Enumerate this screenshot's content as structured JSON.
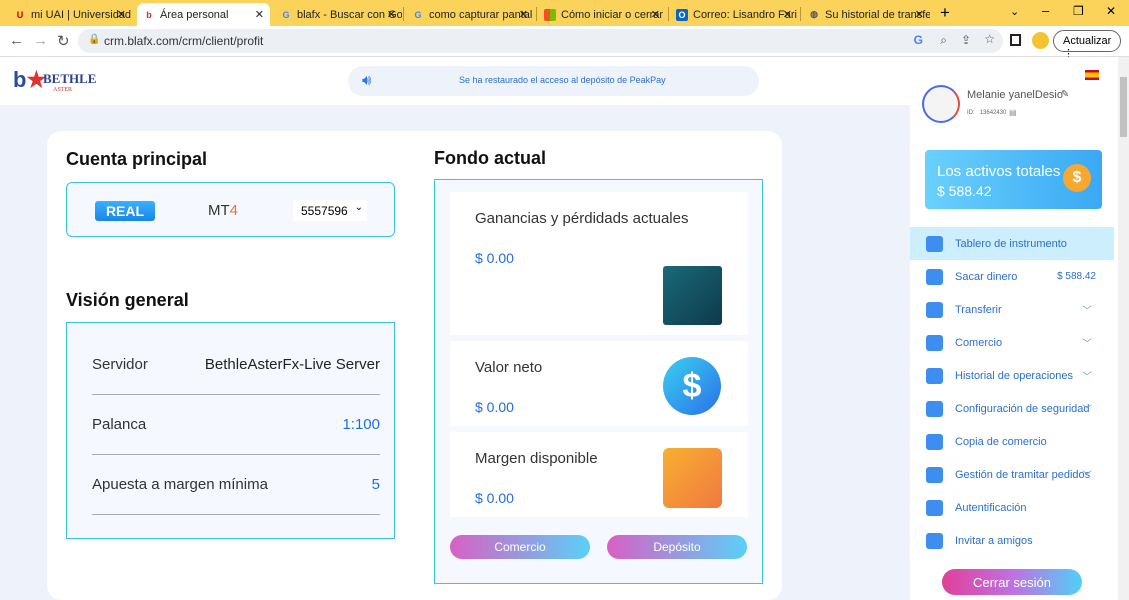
{
  "browser": {
    "tabs": [
      {
        "label": "mi UAI | Universidad A",
        "icon": "uai-icon"
      },
      {
        "label": "Área personal",
        "icon": "bethle-icon",
        "active": true
      },
      {
        "label": "blafx - Buscar con Go",
        "icon": "google-icon"
      },
      {
        "label": "como capturar pantal",
        "icon": "google-icon"
      },
      {
        "label": "Cómo iniciar o cerrar",
        "icon": "microsoft-icon"
      },
      {
        "label": "Correo: Lisandro Fari",
        "icon": "outlook-icon"
      },
      {
        "label": "Su historial de transfe",
        "icon": "globe-icon"
      }
    ],
    "url": "crm.blafx.com/crm/client/profit",
    "update_label": "Actualizar"
  },
  "header": {
    "logo_top": "BETHLE",
    "logo_bottom": "ASTER",
    "notice": "Se ha restaurado el acceso al depósito de PeakPay"
  },
  "account": {
    "title": "Cuenta principal",
    "type": "REAL",
    "platform": "MT",
    "platform_num": "4",
    "account_number": "5557596"
  },
  "overview": {
    "title": "Visión general",
    "rows": [
      {
        "label": "Servidor",
        "value": "BethleAsterFx-Live Server"
      },
      {
        "label": "Palanca",
        "value": "1:100"
      },
      {
        "label": "Apuesta a margen mínima",
        "value": "5"
      }
    ]
  },
  "fund": {
    "title": "Fondo actual",
    "cards": [
      {
        "label": "Ganancias y pérdidads actuales",
        "value": "$ 0.00"
      },
      {
        "label": "Valor neto",
        "value": "$ 0.00"
      },
      {
        "label": "Margen disponible",
        "value": "$ 0.00"
      }
    ],
    "trade_button": "Comercio",
    "deposit_button": "Depósito"
  },
  "user": {
    "name": "Melanie yanelDesio",
    "id_label": "ID:",
    "id": "13642430"
  },
  "assets": {
    "label": "Los activos totales",
    "value": "$ 588.42"
  },
  "menu": [
    {
      "label": "Tablero de instrumento",
      "active": true
    },
    {
      "label": "Sacar dinero",
      "value": "$ 588.42"
    },
    {
      "label": "Transferir",
      "chevron": true
    },
    {
      "label": "Comercio",
      "chevron": true
    },
    {
      "label": "Historial de operaciones",
      "chevron": true
    },
    {
      "label": "Configuración de seguridad",
      "chevron": true
    },
    {
      "label": "Copia de comercio"
    },
    {
      "label": "Gestión de tramitar pedidos",
      "chevron": true
    },
    {
      "label": "Autentificación"
    },
    {
      "label": "Invitar a amigos"
    }
  ],
  "logout": "Cerrar sesión"
}
